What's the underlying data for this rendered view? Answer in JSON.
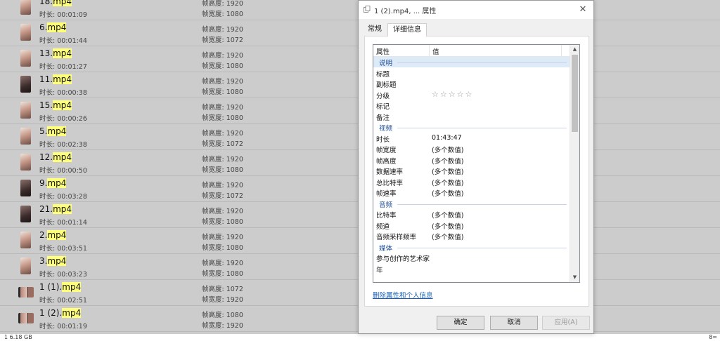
{
  "files": [
    {
      "name_base": "18.",
      "name_ext": "mp4",
      "duration": "时长: 00:01:09",
      "line1": "帧高度: 1920",
      "line2": "帧宽度: 1080",
      "thumb": "portrait"
    },
    {
      "name_base": "6.",
      "name_ext": "mp4",
      "duration": "时长: 00:01:44",
      "line1": "帧高度: 1920",
      "line2": "帧宽度: 1072",
      "thumb": "portrait"
    },
    {
      "name_base": "13.",
      "name_ext": "mp4",
      "duration": "时长: 00:01:27",
      "line1": "帧高度: 1920",
      "line2": "帧宽度: 1080",
      "thumb": "portrait"
    },
    {
      "name_base": "11.",
      "name_ext": "mp4",
      "duration": "时长: 00:00:38",
      "line1": "帧高度: 1920",
      "line2": "帧宽度: 1080",
      "thumb": "dark"
    },
    {
      "name_base": "15.",
      "name_ext": "mp4",
      "duration": "时长: 00:00:26",
      "line1": "帧高度: 1920",
      "line2": "帧宽度: 1080",
      "thumb": "portrait"
    },
    {
      "name_base": "5.",
      "name_ext": "mp4",
      "duration": "时长: 00:02:38",
      "line1": "帧高度: 1920",
      "line2": "帧宽度: 1072",
      "thumb": "portrait"
    },
    {
      "name_base": "12.",
      "name_ext": "mp4",
      "duration": "时长: 00:00:50",
      "line1": "帧高度: 1920",
      "line2": "帧宽度: 1080",
      "thumb": "portrait"
    },
    {
      "name_base": "9.",
      "name_ext": "mp4",
      "duration": "时长: 00:03:28",
      "line1": "帧高度: 1920",
      "line2": "帧宽度: 1072",
      "thumb": "dark"
    },
    {
      "name_base": "21.",
      "name_ext": "mp4",
      "duration": "时长: 00:01:14",
      "line1": "帧高度: 1920",
      "line2": "帧宽度: 1080",
      "thumb": "dark"
    },
    {
      "name_base": "2.",
      "name_ext": "mp4",
      "duration": "时长: 00:03:51",
      "line1": "帧高度: 1920",
      "line2": "帧宽度: 1080",
      "thumb": "portrait"
    },
    {
      "name_base": "3.",
      "name_ext": "mp4",
      "duration": "时长: 00:03:23",
      "line1": "帧高度: 1920",
      "line2": "帧宽度: 1080",
      "thumb": "portrait"
    },
    {
      "name_base": "1 (1).",
      "name_ext": "mp4",
      "duration": "时长: 00:02:51",
      "line1": "帧高度: 1072",
      "line2": "帧宽度: 1920",
      "thumb": "wide"
    },
    {
      "name_base": "1 (2).",
      "name_ext": "mp4",
      "duration": "时长: 00:01:19",
      "line1": "帧高度: 1080",
      "line2": "帧宽度: 1920",
      "thumb": "wide"
    }
  ],
  "status_bar": {
    "label": "1  6.18 GB",
    "right": "8="
  },
  "dialog": {
    "title": "1 (2).mp4, ... 属性",
    "close_glyph": "✕",
    "tabs": {
      "general": "常规",
      "details": "详细信息"
    },
    "columns": {
      "property": "属性",
      "value": "值"
    },
    "rows": [
      {
        "type": "group",
        "label": "说明",
        "selected": true
      },
      {
        "type": "prop",
        "key": "标题",
        "value": ""
      },
      {
        "type": "prop",
        "key": "副标题",
        "value": ""
      },
      {
        "type": "prop",
        "key": "分级",
        "value": "",
        "stars": "☆☆☆☆☆",
        "rating": 0
      },
      {
        "type": "prop",
        "key": "标记",
        "value": ""
      },
      {
        "type": "prop",
        "key": "备注",
        "value": ""
      },
      {
        "type": "group",
        "label": "视频"
      },
      {
        "type": "prop",
        "key": "时长",
        "value": "01:43:47"
      },
      {
        "type": "prop",
        "key": "帧宽度",
        "value": "(多个数值)"
      },
      {
        "type": "prop",
        "key": "帧高度",
        "value": "(多个数值)"
      },
      {
        "type": "prop",
        "key": "数据速率",
        "value": "(多个数值)"
      },
      {
        "type": "prop",
        "key": "总比特率",
        "value": "(多个数值)"
      },
      {
        "type": "prop",
        "key": "帧速率",
        "value": "(多个数值)"
      },
      {
        "type": "group",
        "label": "音频"
      },
      {
        "type": "prop",
        "key": "比特率",
        "value": "(多个数值)"
      },
      {
        "type": "prop",
        "key": "频道",
        "value": "(多个数值)"
      },
      {
        "type": "prop",
        "key": "音频采样频率",
        "value": "(多个数值)"
      },
      {
        "type": "group",
        "label": "媒体"
      },
      {
        "type": "prop",
        "key": "参与创作的艺术家",
        "value": ""
      },
      {
        "type": "prop",
        "key": "年",
        "value": ""
      }
    ],
    "remove_link": "删除属性和个人信息",
    "buttons": {
      "ok": "确定",
      "cancel": "取消",
      "apply": "应用(A)"
    }
  }
}
